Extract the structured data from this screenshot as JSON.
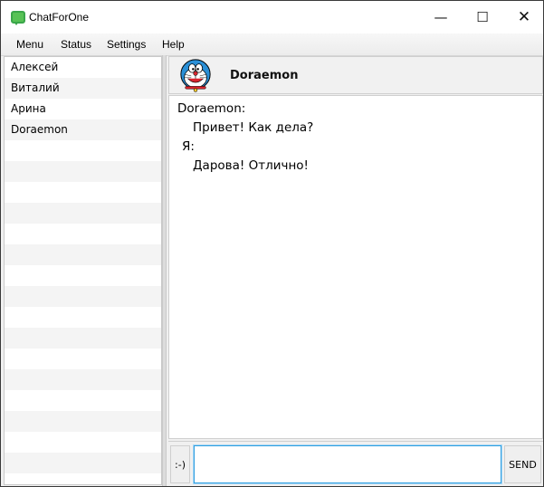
{
  "window": {
    "title": "ChatForOne",
    "minimize": "—",
    "maximize": "☐",
    "close": "✕"
  },
  "menu": [
    "Menu",
    "Status",
    "Settings",
    "Help"
  ],
  "contacts": [
    "Алексей",
    "Виталий",
    "Арина",
    "Doraemon",
    "",
    "",
    "",
    "",
    "",
    "",
    "",
    "",
    "",
    "",
    "",
    "",
    "",
    "",
    "",
    "",
    ""
  ],
  "chat": {
    "name": "Doraemon",
    "avatar_icon": "doraemon-avatar"
  },
  "messages": [
    {
      "text": "Doraemon:"
    },
    {
      "text": "Привет! Как дела?"
    },
    {
      "text": "Я:"
    },
    {
      "text": "Дарова! Отлично!"
    }
  ],
  "input": {
    "emoji_label": ":-)",
    "value": "",
    "send_label": "SEND"
  },
  "colors": {
    "app_icon": "#57c255",
    "input_focus": "#2f9fe0",
    "avatar_blue": "#2a8fd6"
  }
}
